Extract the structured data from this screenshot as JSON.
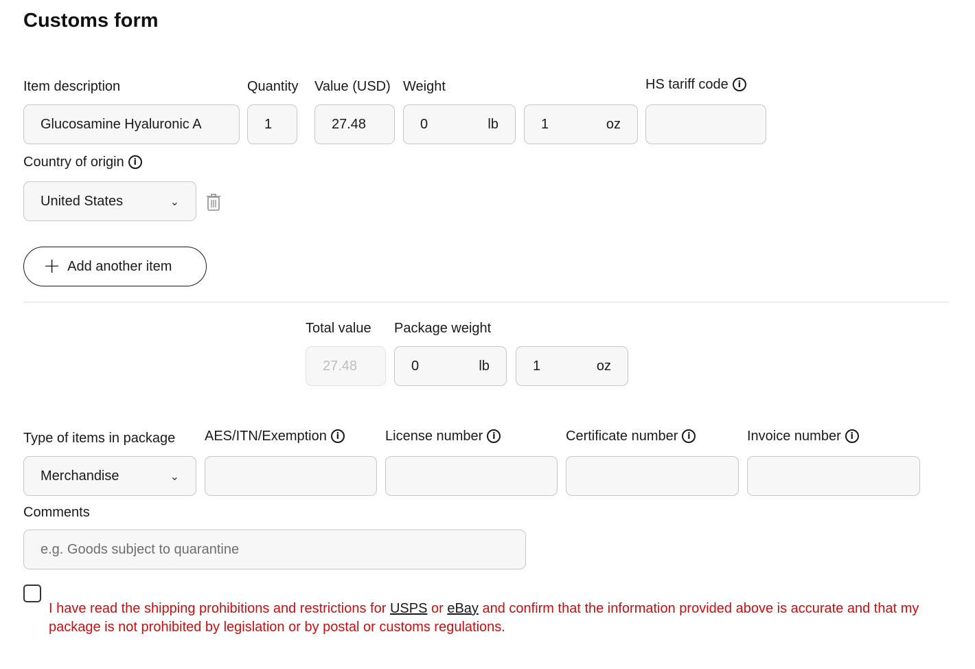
{
  "form": {
    "title": "Customs form"
  },
  "item": {
    "labels": {
      "description": "Item description",
      "quantity": "Quantity",
      "value": "Value (USD)",
      "weight": "Weight",
      "hs_code": "HS tariff code",
      "country": "Country of origin"
    },
    "description": "Glucosamine Hyaluronic A",
    "quantity": "1",
    "value": "27.48",
    "weight_lb": "0",
    "weight_oz": "1",
    "unit_lb": "lb",
    "unit_oz": "oz",
    "hs_code": "",
    "country": "United States"
  },
  "add_item_label": "Add another item",
  "totals": {
    "total_value_label": "Total value",
    "package_weight_label": "Package weight",
    "total_value": "27.48",
    "package_lb": "0",
    "package_oz": "1",
    "unit_lb": "lb",
    "unit_oz": "oz"
  },
  "package": {
    "type_label": "Type of items in package",
    "type_value": "Merchandise",
    "aes_label": "AES/ITN/Exemption",
    "license_label": "License number",
    "certificate_label": "Certificate number",
    "invoice_label": "Invoice number",
    "aes_value": "",
    "license_value": "",
    "certificate_value": "",
    "invoice_value": ""
  },
  "comments": {
    "label": "Comments",
    "placeholder": "e.g. Goods subject to quarantine"
  },
  "disclaimer": {
    "part1": "I have read the shipping prohibitions and restrictions for ",
    "link_usps": "USPS",
    "part2": " or ",
    "link_ebay": "eBay",
    "part3": " and confirm that the information provided above is accurate and that my package is not prohibited by legislation or by postal or customs regulations."
  },
  "icons": {
    "info": "i",
    "chevron": "⌄",
    "plus": "+"
  },
  "colors": {
    "warning_text": "#c70f0f",
    "field_bg": "#f7f7f7",
    "field_border": "#c7c7c7"
  }
}
